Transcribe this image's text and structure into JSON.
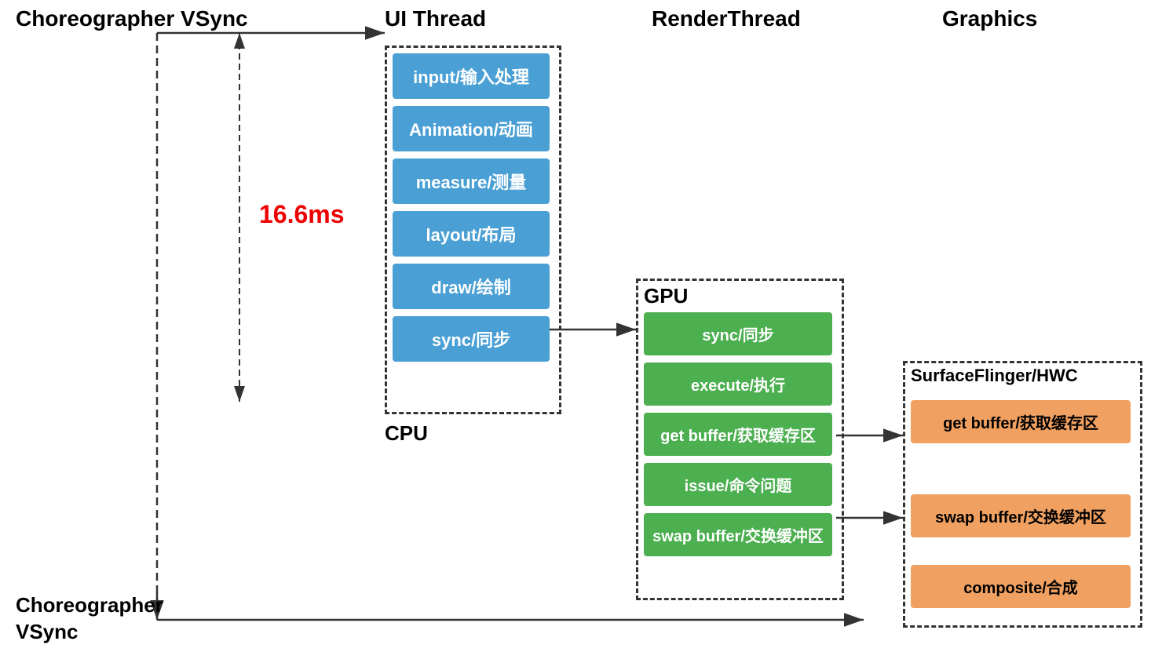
{
  "headers": {
    "choreographer": "Choreographer\nVSync",
    "ui_thread": "UI Thread",
    "render_thread": "RenderThread",
    "graphics": "Graphics"
  },
  "timing": "16.6ms",
  "cpu_label": "CPU",
  "gpu_label": "GPU",
  "sf_label": "SurfaceFlinger/HWC",
  "ui_blocks": [
    "input/输入处理",
    "Animation/动画",
    "measure/测量",
    "layout/布局",
    "draw/绘制",
    "sync/同步"
  ],
  "gpu_blocks": [
    "sync/同步",
    "execute/执行",
    "get buffer/获取缓存区",
    "issue/命令问题",
    "swap buffer/交换缓冲区"
  ],
  "sf_blocks": [
    "get buffer/获取缓存区",
    "swap buffer/交换缓冲区",
    "composite/合成"
  ],
  "choreographer_bottom": "Choreographer\nVSync"
}
